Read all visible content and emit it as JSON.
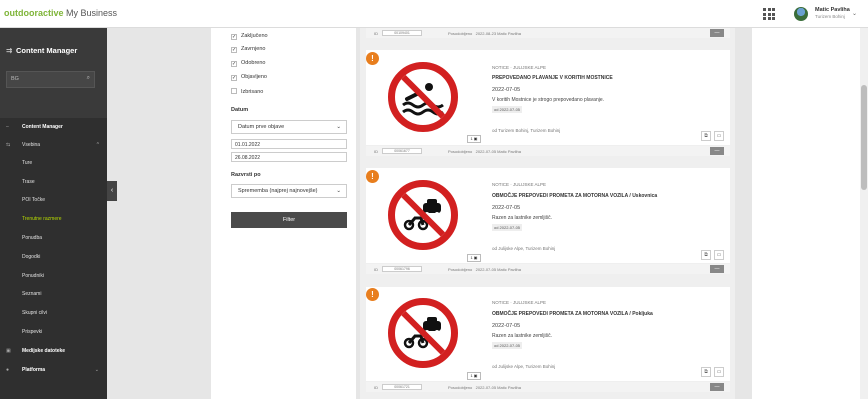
{
  "header": {
    "brand_part1": "outdooractive",
    "brand_part2": " My Business",
    "user_name": "Matic Pavliha",
    "user_org": "Turizem Bohinj"
  },
  "sidebar": {
    "title": "Content Manager",
    "search_value": "BG",
    "items": [
      {
        "label": "Content Manager"
      },
      {
        "label": "Vsebina"
      },
      {
        "label": "Ture"
      },
      {
        "label": "Trase"
      },
      {
        "label": "POI Točke"
      },
      {
        "label": "Trenutne razmere"
      },
      {
        "label": "Ponudba"
      },
      {
        "label": "Dogodki"
      },
      {
        "label": "Ponudniki"
      },
      {
        "label": "Seznami"
      },
      {
        "label": "Skupni cilvi"
      },
      {
        "label": "Prispevki"
      },
      {
        "label": "Medijske datoteke"
      },
      {
        "label": "Platforma"
      }
    ]
  },
  "filters": {
    "checkboxes": [
      {
        "label": "Zaključeno",
        "checked": true
      },
      {
        "label": "Zavrnjeno",
        "checked": true
      },
      {
        "label": "Odobreno",
        "checked": true
      },
      {
        "label": "Objavljeno",
        "checked": true
      },
      {
        "label": "Izbrisano",
        "checked": false
      }
    ],
    "date_label": "Datum",
    "date_select": "Datum prve objave",
    "date_from": "01.01.2022",
    "date_to": "26.08.2022",
    "sort_label": "Razvrsti po",
    "sort_select": "Sprememba (najprej najnovejše)",
    "filter_button": "Filter"
  },
  "items": [
    {
      "id": "00109401",
      "modified": "2022-08-23 Matic Pavliha"
    },
    {
      "category": "NOTICE · JULIJSKE ALPE",
      "title": "PREPOVEDANO PLAVANJE V KORITIH MOSTNICE",
      "date": "2022-07-05",
      "desc": "V koritih Mostnice je strogo prepovedano plavanje.",
      "tag": "od 2022-07-05",
      "source": "od Turizem Bohinj, Turizem Bohinj",
      "image_count": "1",
      "id": "00061677",
      "modified": "2022-07-05 Matic Pavliha"
    },
    {
      "category": "NOTICE · JULIJSKE ALPE",
      "title": "OBMOČJE PREPOVEDI PROMETA ZA MOTORNA VOZILA / Uskovnica",
      "date": "2022-07-05",
      "desc": "Razen za lastnike zemljišč.",
      "tag": "od 2022-07-05",
      "source": "od Julijske Alpe, Turizem Bohinj",
      "image_count": "1",
      "id": "00061796",
      "modified": "2022-07-05 Matic Pavliha"
    },
    {
      "category": "NOTICE · JULIJSKE ALPE",
      "title": "OBMOČJE PREPOVEDI PROMETA ZA MOTORNA VOZILA / Pokljuka",
      "date": "2022-07-05",
      "desc": "Razen za lastnike zemljišč.",
      "tag": "od 2022-07-05",
      "source": "od Julijske Alpe, Turizem Bohinj",
      "image_count": "1",
      "id": "00061721",
      "modified": "2022-07-05 Matic Pavliha"
    }
  ],
  "labels": {
    "id_label": "ID",
    "modified_label": "Posodobljeno"
  },
  "icons": {
    "apps": "apps-grid-icon",
    "search": "search-icon",
    "warning": "warning-icon"
  },
  "colors": {
    "brand_green": "#7fb539",
    "active_lime": "#b5d900",
    "sidebar_bg": "#2f2f2f",
    "warning_orange": "#e87e1e",
    "sign_red": "#d22020"
  }
}
